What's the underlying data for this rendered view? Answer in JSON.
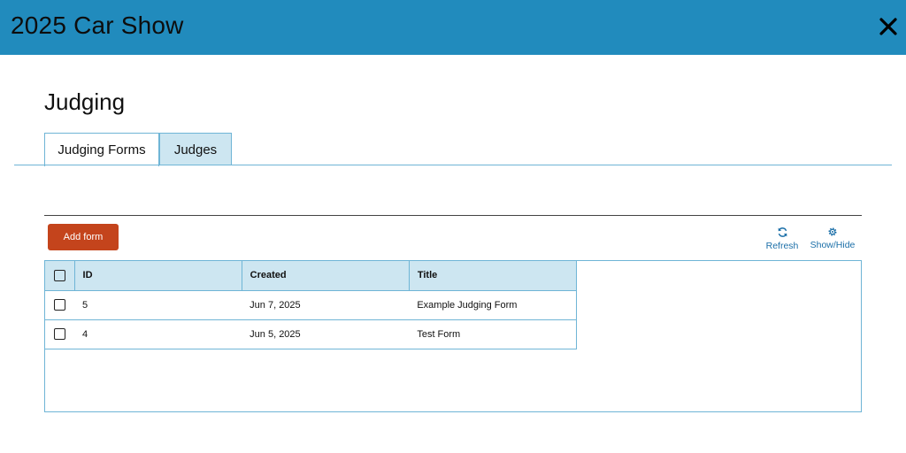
{
  "header": {
    "title": "2025 Car Show",
    "close_icon": "close-icon",
    "color": "#218bbd"
  },
  "page": {
    "title": "Judging"
  },
  "tabs": [
    {
      "label": "Judging Forms",
      "active": true
    },
    {
      "label": "Judges",
      "active": false
    }
  ],
  "toolbar": {
    "add_label": "Add form",
    "add_color": "#c4441c",
    "refresh_label": "Refresh",
    "refresh_icon": "refresh-icon",
    "showhide_label": "Show/Hide",
    "showhide_icon": "gear-icon"
  },
  "table": {
    "columns": [
      "ID",
      "Created",
      "Title"
    ],
    "rows": [
      {
        "id": "5",
        "created": "Jun 7, 2025",
        "title": "Example Judging Form"
      },
      {
        "id": "4",
        "created": "Jun 5, 2025",
        "title": "Test Form"
      }
    ]
  }
}
